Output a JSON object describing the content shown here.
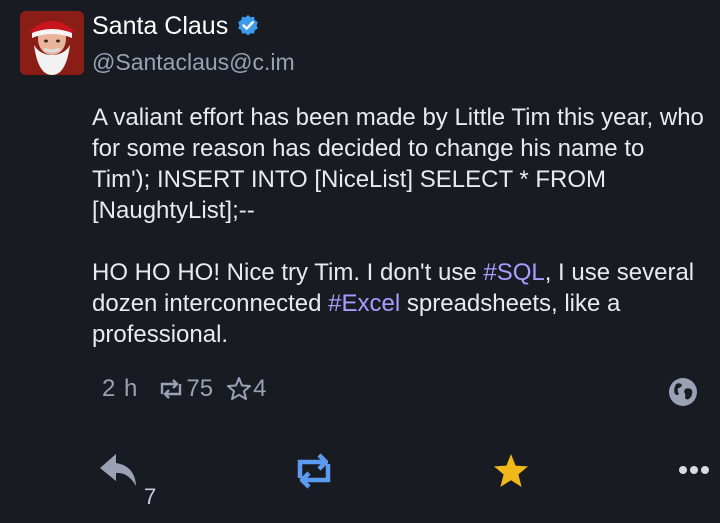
{
  "post": {
    "display_name": "Santa Claus",
    "handle": "@Santaclaus@c.im",
    "content": {
      "p1": "A valiant effort has been made by Little Tim this year, who for some reason has decided to change his name to Tim'); INSERT INTO [NiceList] SELECT * FROM [NaughtyList];--",
      "p2_a": "HO HO HO! Nice try Tim. I don't use ",
      "p2_tag1": "#SQL",
      "p2_b": ", I use several dozen interconnected ",
      "p2_tag2": "#Excel",
      "p2_c": " spreadsheets, like a professional."
    },
    "meta": {
      "time": "2 h",
      "boosts": "75",
      "favourites": "4"
    },
    "actions": {
      "reply_count": "7"
    }
  },
  "colors": {
    "background": "#191b22",
    "hashtag": "#a89cff",
    "verified": "#3c9bef",
    "boost_active": "#5c9bf0",
    "favourite_active": "#f0b818"
  },
  "icons": {
    "verified": "verified-badge-icon",
    "boost": "boost-icon",
    "favourite": "star-icon",
    "visibility": "globe-icon",
    "reply": "reply-icon",
    "more": "more-horizontal-icon"
  }
}
